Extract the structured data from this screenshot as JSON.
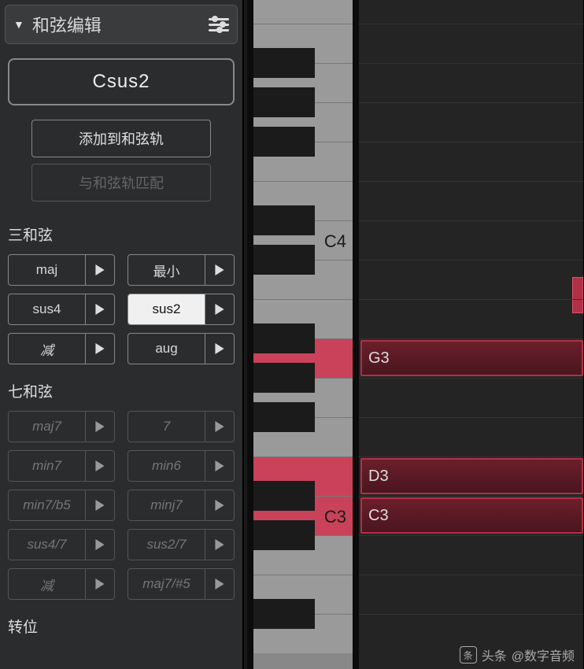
{
  "panel": {
    "title": "和弦编辑"
  },
  "chord_display": "Csus2",
  "actions": {
    "add": "添加到和弦轨",
    "match": "与和弦轨匹配"
  },
  "sections": {
    "triads": {
      "label": "三和弦",
      "buttons": [
        {
          "label": "maj",
          "state": "normal"
        },
        {
          "label": "最小",
          "state": "normal"
        },
        {
          "label": "sus4",
          "state": "normal"
        },
        {
          "label": "sus2",
          "state": "selected"
        },
        {
          "label": "减",
          "state": "normal",
          "italic": true
        },
        {
          "label": "aug",
          "state": "normal"
        }
      ]
    },
    "sevenths": {
      "label": "七和弦",
      "buttons": [
        {
          "label": "maj7",
          "state": "dim"
        },
        {
          "label": "7",
          "state": "dim"
        },
        {
          "label": "min7",
          "state": "dim"
        },
        {
          "label": "min6",
          "state": "dim"
        },
        {
          "label": "min7/b5",
          "state": "dim"
        },
        {
          "label": "minj7",
          "state": "dim"
        },
        {
          "label": "sus4/7",
          "state": "dim"
        },
        {
          "label": "sus2/7",
          "state": "dim"
        },
        {
          "label": "减",
          "state": "dim",
          "italic": true
        },
        {
          "label": "maj7/#5",
          "state": "dim"
        }
      ]
    },
    "inversion": {
      "label": "转位"
    }
  },
  "piano": {
    "labels": {
      "C4": "C4",
      "C3": "C3"
    },
    "highlighted_white": [
      "C3",
      "D3",
      "G3"
    ],
    "highlighted_black": []
  },
  "roll_notes": [
    {
      "pitch": "G3",
      "label": "G3"
    },
    {
      "pitch": "D3",
      "label": "D3"
    },
    {
      "pitch": "C3",
      "label": "C3"
    }
  ],
  "watermark": {
    "prefix": "头条",
    "handle": "@数字音频"
  }
}
